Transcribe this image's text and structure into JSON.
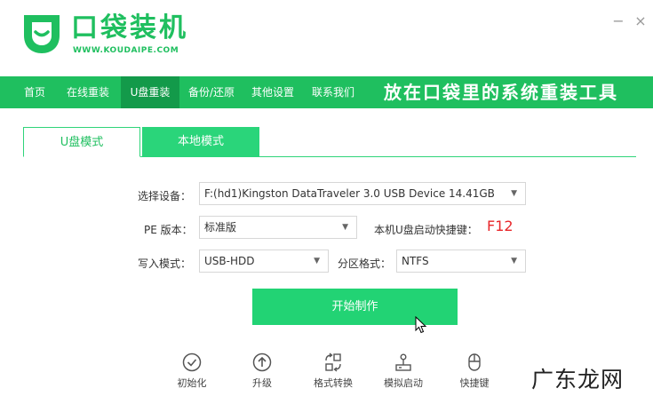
{
  "app": {
    "title": "口袋装机",
    "subtitle": "WWW.KOUDAIPE.COM",
    "brand_color": "#1fbf5f"
  },
  "window_controls": {
    "minimize": "−",
    "close": "×"
  },
  "nav": {
    "items": [
      {
        "label": "首页",
        "active": false
      },
      {
        "label": "在线重装",
        "active": false
      },
      {
        "label": "U盘重装",
        "active": true
      },
      {
        "label": "备份/还原",
        "active": false
      },
      {
        "label": "其他设置",
        "active": false
      },
      {
        "label": "联系我们",
        "active": false
      }
    ],
    "slogan": "放在口袋里的系统重装工具"
  },
  "tabs": [
    {
      "label": "U盘模式",
      "active": true
    },
    {
      "label": "本地模式",
      "active": false
    }
  ],
  "form": {
    "device_label": "选择设备：",
    "device_value": "F:(hd1)Kingston DataTraveler 3.0 USB Device 14.41GB",
    "pe_label": "PE 版本：",
    "pe_value": "标准版",
    "hotkey_label": "本机U盘启动快捷键：",
    "hotkey_value": "F12",
    "write_label": "写入模式：",
    "write_value": "USB-HDD",
    "partition_label": "分区格式：",
    "partition_value": "NTFS"
  },
  "start_button": "开始制作",
  "tools": [
    {
      "label": "初始化",
      "icon": "check-circle-icon"
    },
    {
      "label": "升级",
      "icon": "arrow-up-circle-icon"
    },
    {
      "label": "格式转换",
      "icon": "convert-icon"
    },
    {
      "label": "模拟启动",
      "icon": "joystick-icon"
    },
    {
      "label": "快捷键",
      "icon": "mouse-icon"
    }
  ],
  "watermark": "广东龙网"
}
